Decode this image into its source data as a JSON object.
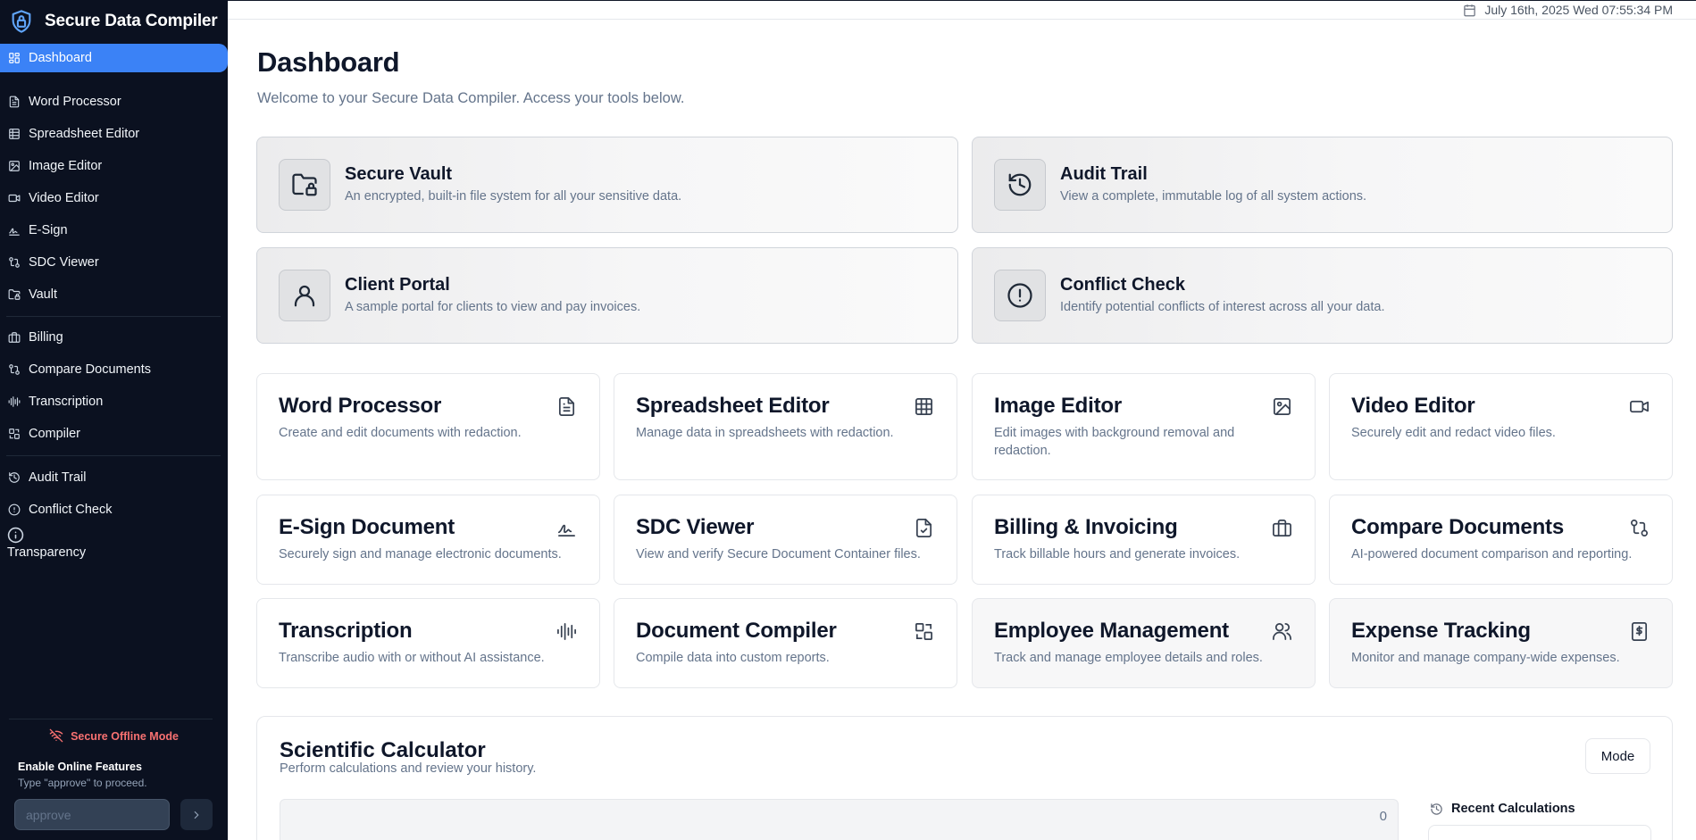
{
  "app": {
    "title": "Secure Data Compiler",
    "accent": "#3b82f6",
    "sidebar_bg": "#0b1120"
  },
  "sidebar": {
    "items": [
      {
        "label": "Dashboard",
        "icon": "dashboard-icon",
        "active": true
      },
      {
        "label": "Word Processor",
        "icon": "document-icon"
      },
      {
        "label": "Spreadsheet Editor",
        "icon": "table-icon"
      },
      {
        "label": "Image Editor",
        "icon": "image-icon"
      },
      {
        "label": "Video Editor",
        "icon": "video-icon"
      },
      {
        "label": "E-Sign",
        "icon": "signature-icon"
      },
      {
        "label": "SDC Viewer",
        "icon": "compare-icon"
      },
      {
        "label": "Vault",
        "icon": "folder-lock-icon"
      },
      {
        "label": "Billing",
        "icon": "briefcase-icon"
      },
      {
        "label": "Compare Documents",
        "icon": "compare-icon"
      },
      {
        "label": "Transcription",
        "icon": "audio-wave-icon"
      },
      {
        "label": "Compiler",
        "icon": "compiler-icon"
      },
      {
        "label": "Audit Trail",
        "icon": "history-icon"
      },
      {
        "label": "Conflict Check",
        "icon": "alert-circle-icon"
      },
      {
        "label": "Transparency",
        "icon": "info-icon"
      }
    ],
    "offline_label": "Secure Offline Mode",
    "offline_color": "#f87171",
    "enable_title": "Enable Online Features",
    "enable_hint": "Type \"approve\" to proceed.",
    "approve_placeholder": "approve"
  },
  "topbar": {
    "datetime": "July 16th, 2025 Wed 07:55:34 PM"
  },
  "main": {
    "title": "Dashboard",
    "subtitle": "Welcome to your Secure Data Compiler. Access your tools below.",
    "features": [
      {
        "title": "Secure Vault",
        "desc": "An encrypted, built-in file system for all your sensitive data.",
        "icon": "folder-lock-icon"
      },
      {
        "title": "Audit Trail",
        "desc": "View a complete, immutable log of all system actions.",
        "icon": "history-icon"
      },
      {
        "title": "Client Portal",
        "desc": "A sample portal for clients to view and pay invoices.",
        "icon": "user-icon"
      },
      {
        "title": "Conflict Check",
        "desc": "Identify potential conflicts of interest across all your data.",
        "icon": "alert-circle-icon"
      }
    ],
    "tools": [
      {
        "title": "Word Processor",
        "desc": "Create and edit documents with redaction.",
        "icon": "document-icon"
      },
      {
        "title": "Spreadsheet Editor",
        "desc": "Manage data in spreadsheets with redaction.",
        "icon": "table-icon"
      },
      {
        "title": "Image Editor",
        "desc": "Edit images with background removal and redaction.",
        "icon": "image-icon"
      },
      {
        "title": "Video Editor",
        "desc": "Securely edit and redact video files.",
        "icon": "video-icon"
      },
      {
        "title": "E-Sign Document",
        "desc": "Securely sign and manage electronic documents.",
        "icon": "signature-icon"
      },
      {
        "title": "SDC Viewer",
        "desc": "View and verify Secure Document Container files.",
        "icon": "file-check-icon"
      },
      {
        "title": "Billing & Invoicing",
        "desc": "Track billable hours and generate invoices.",
        "icon": "briefcase-icon"
      },
      {
        "title": "Compare Documents",
        "desc": "AI-powered document comparison and reporting.",
        "icon": "compare-icon"
      },
      {
        "title": "Transcription",
        "desc": "Transcribe audio with or without AI assistance.",
        "icon": "audio-wave-icon"
      },
      {
        "title": "Document Compiler",
        "desc": "Compile data into custom reports.",
        "icon": "compiler-icon"
      },
      {
        "title": "Employee Management",
        "desc": "Track and manage employee details and roles.",
        "icon": "users-icon"
      },
      {
        "title": "Expense Tracking",
        "desc": "Monitor and manage company-wide expenses.",
        "icon": "receipt-icon"
      }
    ],
    "calculator": {
      "title": "Scientific Calculator",
      "subtitle": "Perform calculations and review your history.",
      "mode_label": "Mode",
      "display_value": "0",
      "recent_label": "Recent Calculations"
    }
  }
}
